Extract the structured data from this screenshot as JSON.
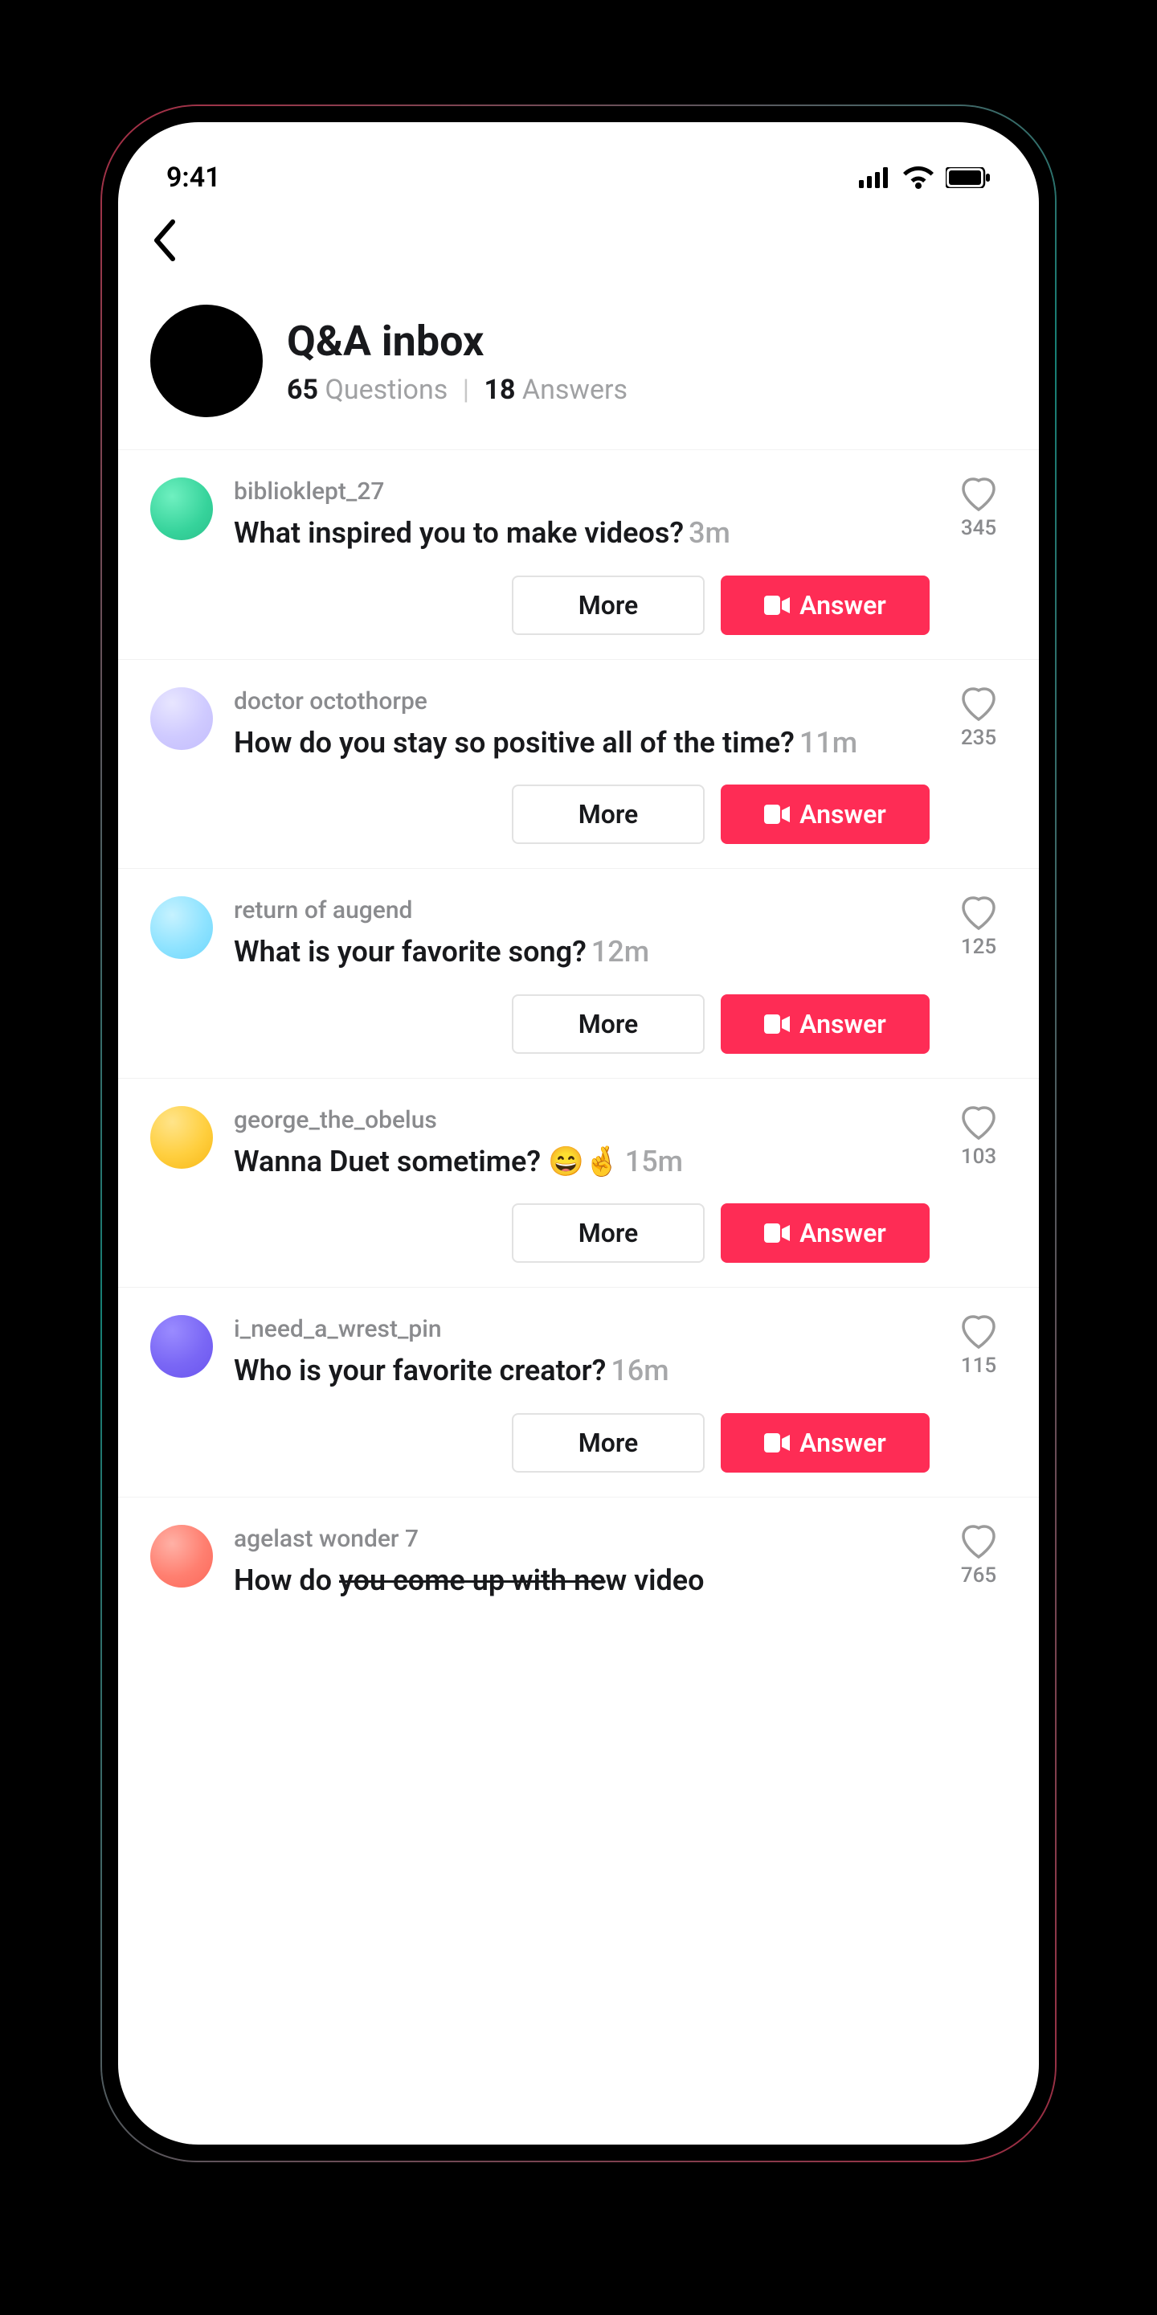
{
  "statusbar": {
    "time": "9:41"
  },
  "header": {
    "title": "Q&A inbox",
    "questions_count": "65",
    "questions_label": "Questions",
    "answers_count": "18",
    "answers_label": "Answers"
  },
  "buttons": {
    "more": "More",
    "answer": "Answer"
  },
  "items": [
    {
      "user": "biblioklept_27",
      "q": "What inspired you to make videos?",
      "time": "3m",
      "likes": "345"
    },
    {
      "user": "doctor octothorpe",
      "q": "How do you stay so positive all of the time?",
      "time": "11m",
      "likes": "235"
    },
    {
      "user": "return of augend",
      "q": "What is your favorite song?",
      "time": "12m",
      "likes": "125"
    },
    {
      "user": "george_the_obelus",
      "q": "Wanna Duet sometime? 😄🤞",
      "time": "15m",
      "likes": "103"
    },
    {
      "user": "i_need_a_wrest_pin",
      "q": "Who is your favorite creator?",
      "time": "16m",
      "likes": "115"
    },
    {
      "user": "agelast wonder 7",
      "q_pre": "How do ",
      "q_strike": "you come up with ne",
      "q_post": "w video",
      "time": "",
      "likes": "765"
    }
  ]
}
